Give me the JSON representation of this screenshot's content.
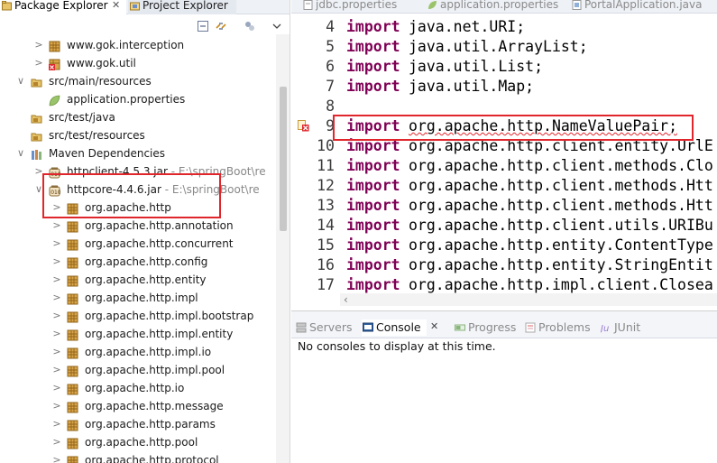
{
  "left_tabs": {
    "package_explorer": "Package Explorer",
    "project_explorer": "Project Explorer",
    "close_glyph": "✕"
  },
  "tree": [
    {
      "label": "www.gok.interception",
      "path": "",
      "kind": "package-pkg"
    },
    {
      "label": "www.gok.util",
      "path": "",
      "kind": "package-err"
    },
    {
      "label": "src/main/resources",
      "path": "",
      "kind": "src-folder"
    },
    {
      "label": "application.properties",
      "path": "",
      "kind": "props-file"
    },
    {
      "label": "src/test/java",
      "path": "",
      "kind": "src-folder"
    },
    {
      "label": "src/test/resources",
      "path": "",
      "kind": "src-folder"
    },
    {
      "label": "Maven Dependencies",
      "path": "",
      "kind": "library"
    },
    {
      "label": "httpclient-4.5.3.jar",
      "path": " - E:\\springBoot\\re",
      "kind": "jar"
    },
    {
      "label": "httpcore-4.4.6.jar",
      "path": " - E:\\springBoot\\re",
      "kind": "jar"
    },
    {
      "label": "org.apache.http",
      "path": "",
      "kind": "package"
    },
    {
      "label": "org.apache.http.annotation",
      "path": "",
      "kind": "package"
    },
    {
      "label": "org.apache.http.concurrent",
      "path": "",
      "kind": "package"
    },
    {
      "label": "org.apache.http.config",
      "path": "",
      "kind": "package"
    },
    {
      "label": "org.apache.http.entity",
      "path": "",
      "kind": "package"
    },
    {
      "label": "org.apache.http.impl",
      "path": "",
      "kind": "package"
    },
    {
      "label": "org.apache.http.impl.bootstrap",
      "path": "",
      "kind": "package"
    },
    {
      "label": "org.apache.http.impl.entity",
      "path": "",
      "kind": "package"
    },
    {
      "label": "org.apache.http.impl.io",
      "path": "",
      "kind": "package"
    },
    {
      "label": "org.apache.http.impl.pool",
      "path": "",
      "kind": "package"
    },
    {
      "label": "org.apache.http.io",
      "path": "",
      "kind": "package"
    },
    {
      "label": "org.apache.http.message",
      "path": "",
      "kind": "package"
    },
    {
      "label": "org.apache.http.params",
      "path": "",
      "kind": "package"
    },
    {
      "label": "org.apache.http.pool",
      "path": "",
      "kind": "package"
    },
    {
      "label": "org.apache.http.protocol",
      "path": "",
      "kind": "package"
    }
  ],
  "editor_tabs": {
    "jdbc": "jdbc.properties",
    "app": "application.properties",
    "portal": "PortalApplication.java"
  },
  "code": [
    {
      "n": "4",
      "kw": "import",
      "pkg": "java.net.URI;"
    },
    {
      "n": "5",
      "kw": "import",
      "pkg": "java.util.ArrayList;"
    },
    {
      "n": "6",
      "kw": "import",
      "pkg": "java.util.List;"
    },
    {
      "n": "7",
      "kw": "import",
      "pkg": "java.util.Map;"
    },
    {
      "n": "8",
      "kw": "",
      "pkg": ""
    },
    {
      "n": "9",
      "kw": "import",
      "pkg": "org.apache.http.NameValuePair;"
    },
    {
      "n": "10",
      "kw": "import",
      "pkg": "org.apache.http.client.entity.UrlE"
    },
    {
      "n": "11",
      "kw": "import",
      "pkg": "org.apache.http.client.methods.Clo"
    },
    {
      "n": "12",
      "kw": "import",
      "pkg": "org.apache.http.client.methods.Htt"
    },
    {
      "n": "13",
      "kw": "import",
      "pkg": "org.apache.http.client.methods.Htt"
    },
    {
      "n": "14",
      "kw": "import",
      "pkg": "org.apache.http.client.utils.URIBu"
    },
    {
      "n": "15",
      "kw": "import",
      "pkg": "org.apache.http.entity.ContentType"
    },
    {
      "n": "16",
      "kw": "import",
      "pkg": "org.apache.http.entity.StringEntit"
    },
    {
      "n": "17",
      "kw": "import",
      "pkg": "org.apache.http.impl.client.Closea"
    }
  ],
  "console_tabs": {
    "servers": "Servers",
    "console": "Console",
    "progress": "Progress",
    "problems": "Problems",
    "junit": "JUnit"
  },
  "console_message": "No consoles to display at this time.",
  "colors": {
    "keyword": "#7f0055",
    "highlight": "#e0262c",
    "package_icon": "#b5832b",
    "jar_icon": "#8a6d3b"
  }
}
